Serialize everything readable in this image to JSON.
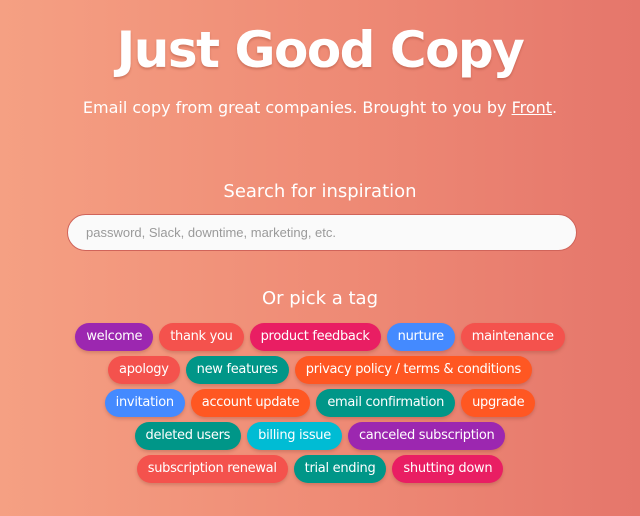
{
  "header": {
    "title": "Just Good Copy",
    "subtitle_prefix": "Email copy from great companies. Brought to you by ",
    "subtitle_link": "Front",
    "subtitle_suffix": "."
  },
  "search": {
    "label": "Search for inspiration",
    "placeholder": "password, Slack, downtime, marketing, etc.",
    "value": ""
  },
  "tags": {
    "label": "Or pick a tag",
    "colors": {
      "purple": "#9c27b0",
      "red": "#f4524d",
      "pink": "#e91e63",
      "blue": "#448aff",
      "teal": "#009688",
      "orange": "#ff5722",
      "cyan": "#00bcd4"
    },
    "rows": [
      [
        {
          "label": "welcome",
          "color": "#9c27b0"
        },
        {
          "label": "thank you",
          "color": "#f4524d"
        },
        {
          "label": "product feedback",
          "color": "#e91e63"
        },
        {
          "label": "nurture",
          "color": "#448aff"
        },
        {
          "label": "maintenance",
          "color": "#f4524d"
        }
      ],
      [
        {
          "label": "apology",
          "color": "#f4524d"
        },
        {
          "label": "new features",
          "color": "#009688"
        },
        {
          "label": "privacy policy / terms & conditions",
          "color": "#ff5722"
        }
      ],
      [
        {
          "label": "invitation",
          "color": "#448aff"
        },
        {
          "label": "account update",
          "color": "#ff5722"
        },
        {
          "label": "email confirmation",
          "color": "#009688"
        },
        {
          "label": "upgrade",
          "color": "#ff5722"
        }
      ],
      [
        {
          "label": "deleted users",
          "color": "#009688"
        },
        {
          "label": "billing issue",
          "color": "#00bcd4"
        },
        {
          "label": "canceled subscription",
          "color": "#9c27b0"
        }
      ],
      [
        {
          "label": "subscription renewal",
          "color": "#f4524d"
        },
        {
          "label": "trial ending",
          "color": "#009688"
        },
        {
          "label": "shutting down",
          "color": "#e91e63"
        }
      ]
    ]
  }
}
